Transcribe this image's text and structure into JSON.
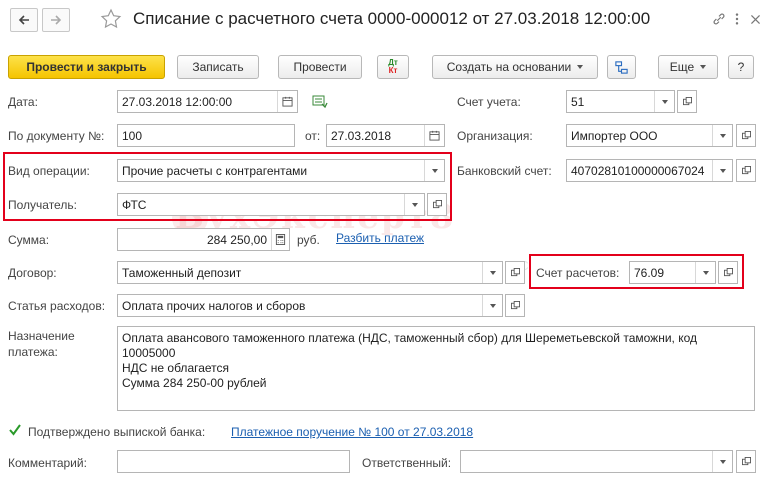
{
  "window": {
    "title": "Списание с расчетного счета 0000-000012 от 27.03.2018 12:00:00"
  },
  "toolbar": {
    "post_close": "Провести и закрыть",
    "save": "Записать",
    "post": "Провести",
    "dtkt_top": "Дт",
    "dtkt_bottom": "Кт",
    "create_based": "Создать на основании",
    "more": "Еще",
    "help": "?"
  },
  "form": {
    "date_label": "Дата:",
    "date_value": "27.03.2018 12:00:00",
    "account_label": "Счет учета:",
    "account_value": "51",
    "doc_no_label": "По документу №:",
    "doc_no_value": "100",
    "from_label": "от:",
    "from_value": "27.03.2018",
    "org_label": "Организация:",
    "org_value": "Импортер ООО",
    "op_type_label": "Вид операции:",
    "op_type_value": "Прочие расчеты с контрагентами",
    "bank_acc_label": "Банковский счет:",
    "bank_acc_value": "40702810100000067024",
    "recipient_label": "Получатель:",
    "recipient_value": "ФТС",
    "amount_label": "Сумма:",
    "amount_value": "284 250,00",
    "currency": "руб.",
    "split_link": "Разбить платеж",
    "contract_label": "Договор:",
    "contract_value": "Таможенный депозит",
    "settle_acc_label": "Счет расчетов:",
    "settle_acc_value": "76.09",
    "expense_label": "Статья расходов:",
    "expense_value": "Оплата прочих налогов и сборов",
    "purpose_label": "Назначение платежа:",
    "purpose_lines": [
      "Оплата авансового таможенного платежа (НДС, таможенный сбор) для Шереметьевской таможни, код",
      "10005000",
      "НДС не облагается",
      "Сумма 284 250-00 рублей"
    ],
    "confirmed_label": "Подтверждено выпиской банка:",
    "confirmed_checked": true,
    "payment_order_link": "Платежное поручение № 100 от 27.03.2018",
    "comment_label": "Комментарий:",
    "comment_value": "",
    "responsible_label": "Ответственный:",
    "responsible_value": ""
  },
  "watermark": {
    "main": "БухЭксперт8",
    "sub": "База ответов по учету в 1С"
  },
  "colors": {
    "primary_button": "#f5c400",
    "highlight_border": "#e3001b",
    "link": "#1b5fb0"
  }
}
